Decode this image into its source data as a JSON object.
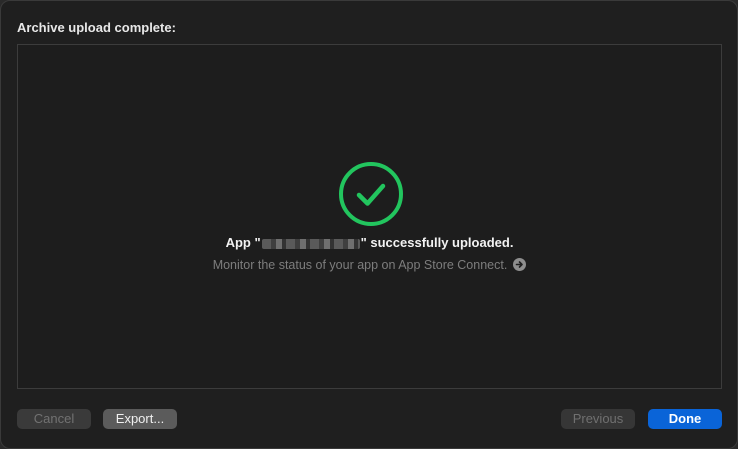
{
  "dialog": {
    "title": "Archive upload complete:"
  },
  "status": {
    "icon": "checkmark-circle-icon",
    "success_color": "#22c55e",
    "message_prefix": "App \"",
    "message_suffix": "\" successfully uploaded.",
    "subtext": "Monitor the status of your app on App Store Connect.",
    "link_icon": "arrow-right-circle-icon"
  },
  "buttons": {
    "cancel": "Cancel",
    "export": "Export...",
    "previous": "Previous",
    "done": "Done"
  },
  "colors": {
    "accent": "#0a64d8",
    "background": "#1f1f1f"
  }
}
